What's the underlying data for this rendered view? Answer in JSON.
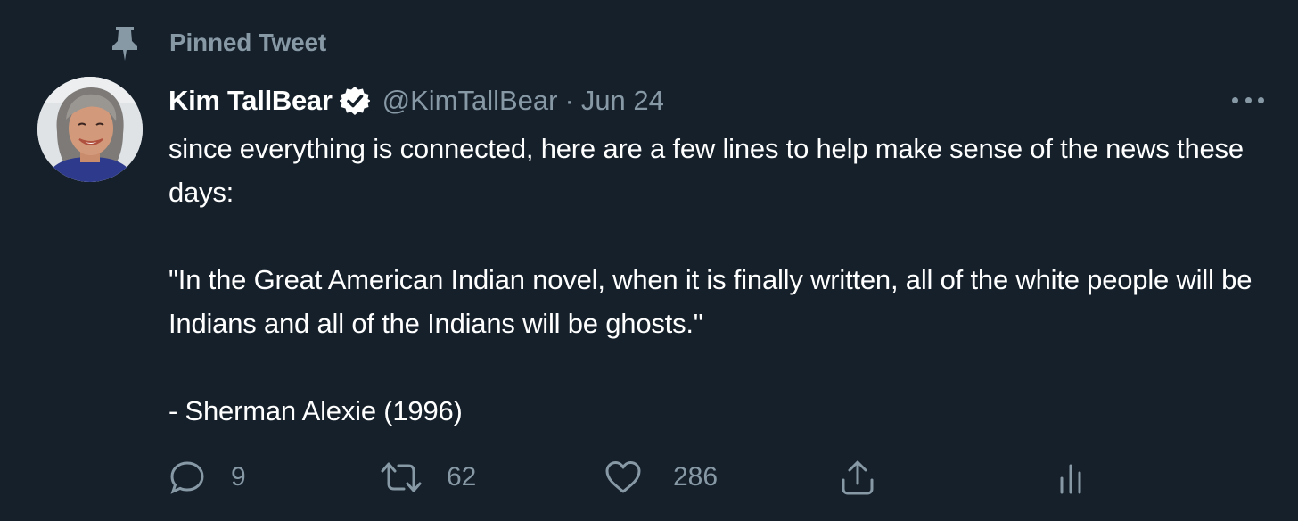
{
  "pinned": {
    "label": "Pinned Tweet",
    "icon": "pin-icon"
  },
  "author": {
    "display_name": "Kim TallBear",
    "verified": true,
    "handle": "@KimTallBear",
    "separator": "·",
    "date": "Jun 24"
  },
  "tweet": {
    "text": "since everything is connected, here are a few lines to help make sense of the news these days:\n\n\"In the Great American Indian novel, when it is finally written, all of the white people will be Indians and all of the Indians will be ghosts.\"\n\n- Sherman Alexie (1996)"
  },
  "actions": {
    "reply_count": "9",
    "retweet_count": "62",
    "like_count": "286"
  },
  "colors": {
    "background": "#15202b",
    "primary_text": "#ffffff",
    "secondary_text": "#8899a6"
  }
}
